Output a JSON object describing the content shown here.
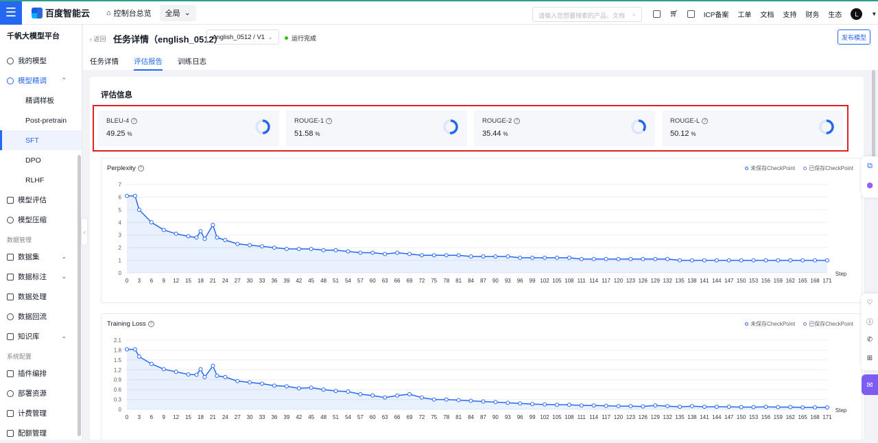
{
  "topbar": {
    "brand": "百度智能云",
    "console": "控制台总览",
    "region": "全局",
    "search_placeholder": "请输入您想要搜索的产品、文档",
    "links": [
      "ICP备案",
      "工单",
      "文档",
      "支持",
      "财务",
      "生态"
    ],
    "avatar": "L"
  },
  "sidebar": {
    "title": "千帆大模型平台",
    "items_top": [
      {
        "label": "我的模型",
        "icon": "model-icon"
      }
    ],
    "tuning": {
      "label": "模型精调",
      "children": [
        "精调样板",
        "Post-pretrain",
        "SFT",
        "DPO",
        "RLHF"
      ],
      "active": "SFT"
    },
    "items_mid": [
      {
        "label": "模型评估",
        "icon": "evaluate-icon"
      },
      {
        "label": "模型压缩",
        "icon": "compress-icon"
      }
    ],
    "group_data": "数据管理",
    "data_items": [
      {
        "label": "数据集",
        "chevron": true
      },
      {
        "label": "数据标注",
        "chevron": true
      },
      {
        "label": "数据处理",
        "chevron": false
      },
      {
        "label": "数据回流",
        "chevron": false
      },
      {
        "label": "知识库",
        "chevron": true
      }
    ],
    "group_system": "系统配置",
    "system_items": [
      {
        "label": "插件编排"
      },
      {
        "label": "部署资源"
      },
      {
        "label": "计费管理"
      },
      {
        "label": "配额管理"
      }
    ]
  },
  "header": {
    "back": "返回",
    "title": "任务详情（english_0512）",
    "version": "english_0512 / V1",
    "status": "运行完成",
    "publish": "发布模型",
    "tabs": [
      "任务详情",
      "评估报告",
      "训练日志"
    ],
    "active_tab": 1
  },
  "eval": {
    "title": "评估信息",
    "metrics": [
      {
        "name": "BLEU-4",
        "value": "49.25",
        "unit": "%",
        "fraction": 0.4925
      },
      {
        "name": "ROUGE-1",
        "value": "51.58",
        "unit": "%",
        "fraction": 0.5158
      },
      {
        "name": "ROUGE-2",
        "value": "35.44",
        "unit": "%",
        "fraction": 0.3544
      },
      {
        "name": "ROUGE-L",
        "value": "50.12",
        "unit": "%",
        "fraction": 0.5012
      }
    ]
  },
  "legend": {
    "unsaved": "未保存CheckPoint",
    "saved": "已保存CheckPoint"
  },
  "colors": {
    "primary": "#2468f2",
    "saved": "#9b5cf2",
    "alert": "#e02020"
  },
  "chart_data": [
    {
      "type": "line",
      "title": "Perplexity",
      "xlabel": "Step",
      "ylim": [
        0,
        7
      ],
      "yticks": [
        0,
        1,
        2,
        3,
        4,
        5,
        6,
        7
      ],
      "x": [
        0,
        2,
        3,
        6,
        9,
        12,
        15,
        17,
        18,
        19,
        21,
        22,
        24,
        27,
        30,
        33,
        36,
        39,
        42,
        45,
        48,
        51,
        54,
        57,
        60,
        63,
        66,
        69,
        72,
        75,
        78,
        81,
        84,
        87,
        90,
        93,
        96,
        99,
        102,
        105,
        108,
        111,
        114,
        117,
        120,
        123,
        126,
        129,
        132,
        135,
        138,
        141,
        144,
        147,
        150,
        153,
        156,
        159,
        162,
        165,
        168,
        171
      ],
      "series": [
        {
          "values": [
            6.1,
            6.1,
            5.0,
            4.0,
            3.4,
            3.1,
            2.9,
            2.8,
            3.3,
            2.7,
            3.8,
            2.8,
            2.6,
            2.3,
            2.2,
            2.1,
            2.0,
            1.9,
            1.9,
            1.9,
            1.8,
            1.8,
            1.7,
            1.6,
            1.6,
            1.5,
            1.6,
            1.5,
            1.4,
            1.4,
            1.4,
            1.4,
            1.3,
            1.3,
            1.3,
            1.3,
            1.2,
            1.2,
            1.2,
            1.2,
            1.2,
            1.1,
            1.1,
            1.1,
            1.1,
            1.1,
            1.1,
            1.1,
            1.1,
            1.0,
            1.0,
            1.0,
            1.0,
            1.0,
            1.0,
            1.0,
            1.0,
            1.0,
            1.0,
            1.0,
            1.0,
            1.0
          ]
        }
      ]
    },
    {
      "type": "line",
      "title": "Training Loss",
      "xlabel": "Step",
      "ylim": [
        0,
        2.1
      ],
      "yticks": [
        0,
        0.3,
        0.6,
        0.9,
        1.2,
        1.5,
        1.8,
        2.1
      ],
      "x": [
        0,
        2,
        3,
        6,
        9,
        12,
        15,
        17,
        18,
        19,
        21,
        22,
        24,
        27,
        30,
        33,
        36,
        39,
        42,
        45,
        48,
        51,
        54,
        57,
        60,
        63,
        66,
        69,
        72,
        75,
        78,
        81,
        84,
        87,
        90,
        93,
        96,
        99,
        102,
        105,
        108,
        111,
        114,
        117,
        120,
        123,
        126,
        129,
        132,
        135,
        138,
        141,
        144,
        147,
        150,
        153,
        156,
        159,
        162,
        165,
        168,
        171
      ],
      "series": [
        {
          "values": [
            1.82,
            1.82,
            1.6,
            1.38,
            1.22,
            1.14,
            1.06,
            1.05,
            1.22,
            0.98,
            1.32,
            1.02,
            0.98,
            0.86,
            0.82,
            0.78,
            0.72,
            0.7,
            0.64,
            0.66,
            0.6,
            0.56,
            0.54,
            0.46,
            0.42,
            0.36,
            0.42,
            0.46,
            0.36,
            0.3,
            0.3,
            0.28,
            0.26,
            0.24,
            0.22,
            0.2,
            0.18,
            0.16,
            0.15,
            0.14,
            0.14,
            0.12,
            0.12,
            0.11,
            0.1,
            0.1,
            0.09,
            0.12,
            0.1,
            0.08,
            0.1,
            0.08,
            0.08,
            0.08,
            0.07,
            0.07,
            0.08,
            0.07,
            0.07,
            0.06,
            0.06,
            0.06
          ]
        }
      ]
    }
  ],
  "x_tick_labels": [
    "0",
    "3",
    "6",
    "9",
    "12",
    "15",
    "18",
    "21",
    "24",
    "27",
    "30",
    "33",
    "36",
    "39",
    "42",
    "45",
    "48",
    "51",
    "54",
    "57",
    "60",
    "63",
    "66",
    "69",
    "72",
    "75",
    "78",
    "81",
    "84",
    "87",
    "90",
    "93",
    "96",
    "99",
    "102",
    "105",
    "108",
    "111",
    "114",
    "117",
    "120",
    "123",
    "126",
    "129",
    "132",
    "135",
    "138",
    "141",
    "144",
    "147",
    "150",
    "153",
    "156",
    "159",
    "162",
    "165",
    "168",
    "171"
  ]
}
